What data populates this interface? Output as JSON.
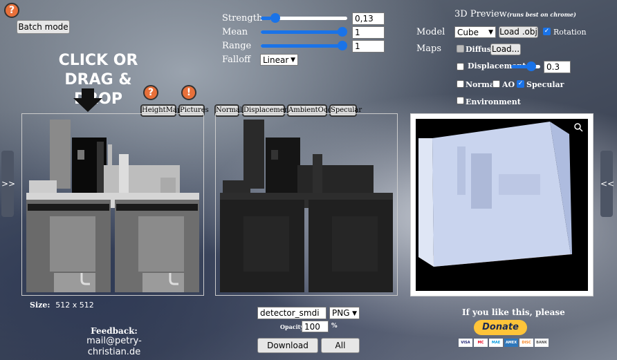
{
  "top_left": {
    "batch_label": "Batch mode",
    "help_icon": "?"
  },
  "drop": {
    "line1": "CLICK OR",
    "line2": "DRAG & DROP"
  },
  "input_tabs": {
    "heightmap": "HeightMap",
    "pictures": "Pictures",
    "help_icon": "?",
    "warn_icon": "!"
  },
  "controls": {
    "strength": {
      "label": "Strength",
      "value": "0,13",
      "level": 0.13
    },
    "mean": {
      "label": "Mean",
      "value": "1",
      "level": 1.0
    },
    "range": {
      "label": "Range",
      "value": "1",
      "level": 1.0
    },
    "falloff": {
      "label": "Falloff",
      "value": "Linear"
    }
  },
  "output_tabs": [
    "Normal",
    "Displacement",
    "AmbientOcc",
    "Specular"
  ],
  "preview": {
    "title": "3D Preview",
    "subtitle": "(runs best on chrome)",
    "model_label": "Model",
    "model_value": "Cube",
    "load_obj": "Load .obj",
    "rotation_label": "Rotation",
    "maps_label": "Maps",
    "diffuse_label": "Diffuse",
    "diffuse_load": "Load...",
    "displacement_label": "Displacement",
    "displacement_value": "0.3",
    "displacement_level": 0.78,
    "normal_label": "Normal",
    "ao_label": "AO",
    "specular_label": "Specular",
    "environment_label": "Environment"
  },
  "size": {
    "label": "Size:",
    "value": "512 x 512"
  },
  "feedback": {
    "label": "Feedback:",
    "email": "mail@petry-christian.de"
  },
  "export": {
    "filename": "detector_smdi",
    "format": "PNG",
    "opacity_label": "Opacity",
    "opacity_value": "100",
    "percent": "%",
    "download": "Download",
    "all": "All"
  },
  "donate": {
    "text": "If you like this, please",
    "button": "Donate",
    "cards": [
      "VISA",
      "MC",
      "MAE",
      "AMEX",
      "DISC",
      "BANK"
    ]
  },
  "side": {
    "left": ">>",
    "right": "<<"
  },
  "colors": {
    "accent": "#1a73e8",
    "help": "#e8703a",
    "donate": "#ffc439"
  }
}
